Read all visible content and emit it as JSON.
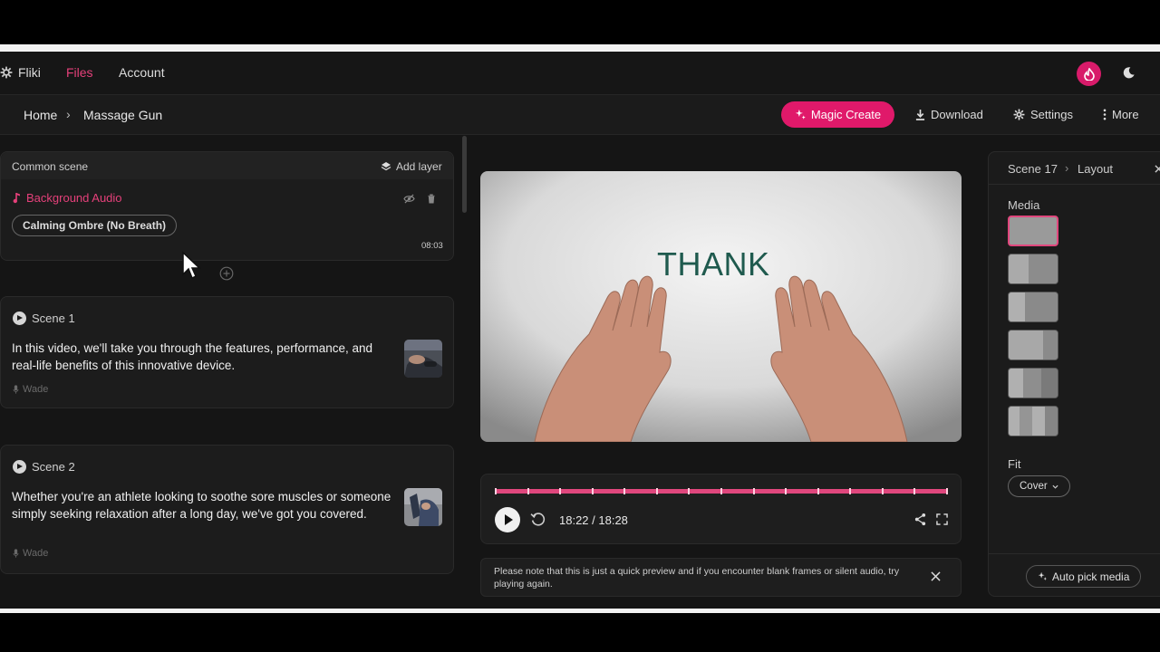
{
  "nav": {
    "brand": "Fliki",
    "links": [
      "Files",
      "Account"
    ]
  },
  "breadcrumb": {
    "home": "Home",
    "separator": "›",
    "current": "Massage Gun"
  },
  "actions": {
    "magic_create": "Magic Create",
    "download": "Download",
    "settings": "Settings",
    "more": "More"
  },
  "common_scene": {
    "title": "Common scene",
    "add_layer": "Add layer",
    "audio_label": "Background Audio",
    "track": "Calming Ombre (No Breath)",
    "duration": "08:03"
  },
  "scenes": [
    {
      "title": "Scene 1",
      "text": "In this video, we'll take you through the features, performance, and real-life benefits of this innovative device.",
      "voice": "Wade"
    },
    {
      "title": "Scene 2",
      "text": "Whether you're an athlete looking to soothe sore muscles or someone simply seeking relaxation after a long day, we've got you covered.",
      "voice": "Wade"
    }
  ],
  "preview": {
    "overlay_text": "THANK"
  },
  "player": {
    "time": "18:22 / 18:28",
    "progress": 1.0
  },
  "notice": {
    "text": "Please note that this is just a quick preview and if you encounter blank frames or silent audio, try playing again."
  },
  "right_panel": {
    "scene": "Scene 17",
    "separator": "›",
    "tab": "Layout",
    "media_label": "Media",
    "fit_label": "Fit",
    "fit_value": "Cover",
    "auto_pick": "Auto pick media"
  },
  "colors": {
    "accent": "#e0196a",
    "background": "#151515",
    "panel": "#1c1c1c"
  }
}
